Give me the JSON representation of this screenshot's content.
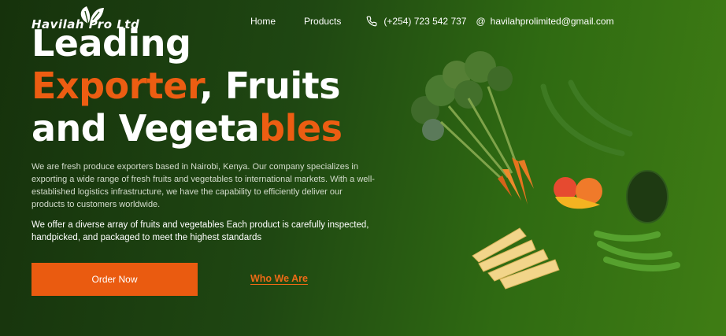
{
  "brand": {
    "name": "Havilah Pro Ltd"
  },
  "nav": {
    "home": "Home",
    "products": "Products",
    "phone": "(+254) 723 542 737",
    "email": "havilahprolimited@gmail.com"
  },
  "hero": {
    "line1": "Leading",
    "line2_accent": "Exporter",
    "line2_rest": ", Fruits",
    "line3_start": "and Vegeta",
    "line3_accent": "bles",
    "paragraph1": "We are fresh produce exporters based in Nairobi, Kenya. Our company specializes in exporting a wide range of fresh fruits and vegetables to international markets. With a well-established logistics infrastructure, we have the capability to efficiently deliver our products to customers worldwide.",
    "paragraph2": "We offer a diverse array of fruits and vegetables Each product is carefully inspected, handpicked, and packaged to meet the highest standards",
    "order_button": "Order Now",
    "who_link": "Who We Are"
  },
  "colors": {
    "accent": "#ea5b10",
    "background_dark": "#16320c",
    "background_light": "#3f7d14"
  },
  "icons": {
    "logo": "leaf-icon",
    "phone": "phone-icon",
    "email": "at-icon"
  }
}
